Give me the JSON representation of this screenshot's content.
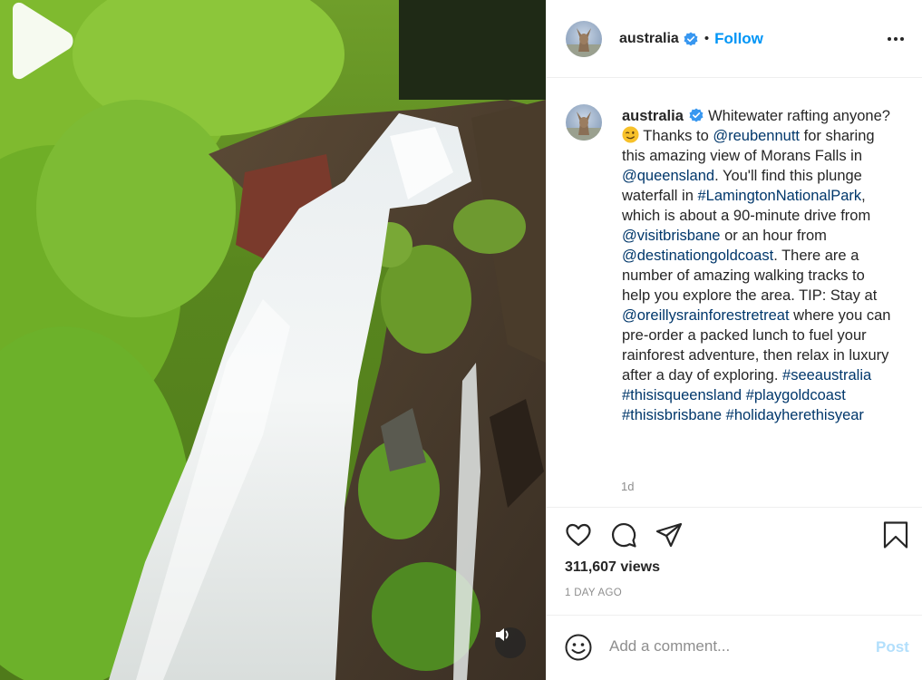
{
  "colors": {
    "accent": "#0095f6",
    "link": "#00376b",
    "muted": "#8e8e8e",
    "post_disabled": "#b2dffc"
  },
  "header": {
    "username": "australia",
    "separator": "•",
    "follow_label": "Follow",
    "verified_icon": "verified-badge-icon",
    "more_icon": "more-options-icon"
  },
  "media": {
    "play_icon": "play-icon",
    "sound_icon": "volume-icon"
  },
  "caption": {
    "username": "australia",
    "text_1": "Whitewater rafting anyone?",
    "emoji": "winking-face-emoji",
    "text_2": "Thanks to",
    "mention_1": "@reubennutt",
    "text_3": "for sharing this amazing view of Morans Falls in",
    "mention_2": "@queensland",
    "text_4": ". You'll find this plunge waterfall in",
    "hashtag_1": "#LamingtonNationalPark",
    "text_5": ", which is about a 90-minute drive from",
    "mention_3": "@visitbrisbane",
    "text_6": "or an hour from",
    "mention_4": "@destinationgoldcoast",
    "text_7": ". There are a number of amazing walking tracks to help you explore the area. TIP: Stay at",
    "mention_5": "@oreillysrainforestretreat",
    "text_8": "where you can pre-order a packed lunch to fuel your rainforest adventure, then relax in luxury after a day of exploring.",
    "hashtags": [
      "#seeaustralia",
      "#thisisqueensland",
      "#playgoldcoast",
      "#thisisbrisbane",
      "#holidayherethisyear"
    ],
    "time_ago": "1d"
  },
  "actions": {
    "like_icon": "heart-icon",
    "comment_icon": "comment-icon",
    "share_icon": "share-icon",
    "save_icon": "bookmark-icon"
  },
  "views": "311,607 views",
  "date_label": "1 DAY AGO",
  "comment_bar": {
    "emoji_icon": "smiley-icon",
    "placeholder": "Add a comment...",
    "post_label": "Post"
  }
}
